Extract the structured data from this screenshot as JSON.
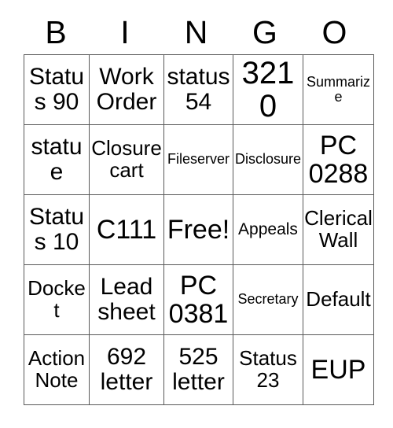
{
  "card": {
    "title": "BINGO",
    "headers": [
      "B",
      "I",
      "N",
      "G",
      "O"
    ],
    "border_color": "#595959",
    "background_color": "#ffffff",
    "text_color": "#000000",
    "rows": 5,
    "columns": 5,
    "free_space_label": "Free!",
    "cells": [
      [
        {
          "text": "Status 90",
          "size": "lg"
        },
        {
          "text": "Work Order",
          "size": "lg"
        },
        {
          "text": "status 54",
          "size": "lg"
        },
        {
          "text": "3210",
          "size": "xxl"
        },
        {
          "text": "Summarize",
          "size": "xs"
        }
      ],
      [
        {
          "text": "statue",
          "size": "lg"
        },
        {
          "text": "Closure cart",
          "size": "md"
        },
        {
          "text": "Fileserver",
          "size": "xs"
        },
        {
          "text": "Disclosure",
          "size": "xs"
        },
        {
          "text": "PC 0288",
          "size": "xl"
        }
      ],
      [
        {
          "text": "Status 10",
          "size": "lg"
        },
        {
          "text": "C111",
          "size": "xl"
        },
        {
          "text": "Free!",
          "size": "xl"
        },
        {
          "text": "Appeals",
          "size": "sm"
        },
        {
          "text": "Clerical Wall",
          "size": "md"
        }
      ],
      [
        {
          "text": "Docket",
          "size": "md"
        },
        {
          "text": "Lead sheet",
          "size": "lg"
        },
        {
          "text": "PC 0381",
          "size": "xl"
        },
        {
          "text": "Secretary",
          "size": "xs"
        },
        {
          "text": "Default",
          "size": "md"
        }
      ],
      [
        {
          "text": "Action Note",
          "size": "md"
        },
        {
          "text": "692 letter",
          "size": "lg"
        },
        {
          "text": "525 letter",
          "size": "lg"
        },
        {
          "text": "Status 23",
          "size": "md"
        },
        {
          "text": "EUP",
          "size": "xl"
        }
      ]
    ]
  }
}
